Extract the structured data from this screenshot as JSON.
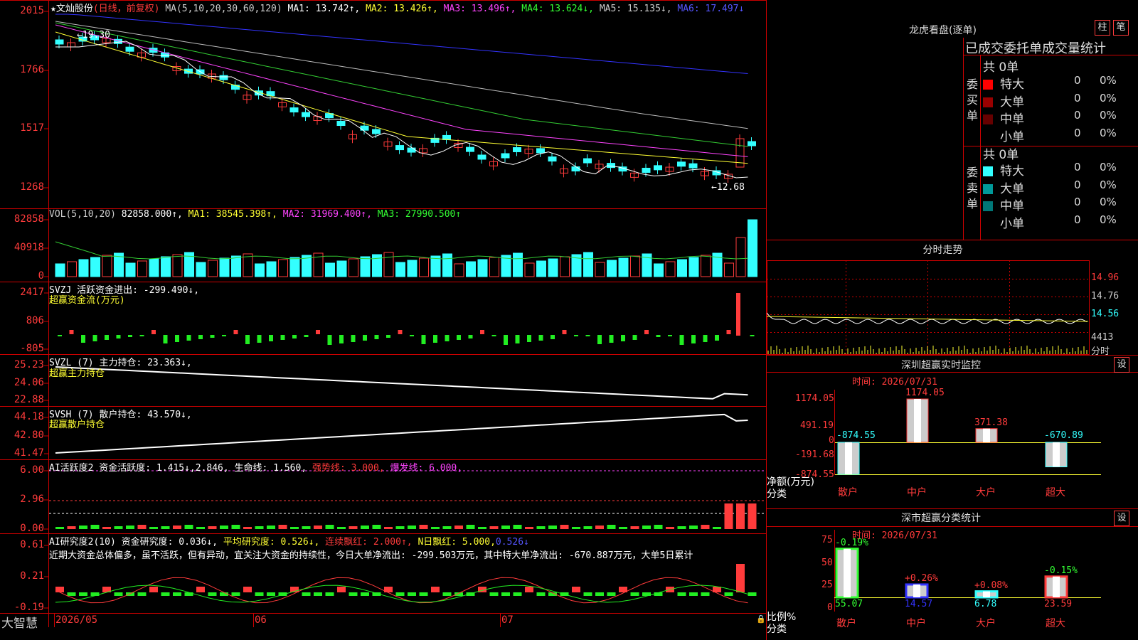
{
  "main_chart": {
    "header": {
      "stock": "★文灿股份",
      "mode": "(日线，前复权)",
      "ma_def": "MA(5,10,20,30,60,120)",
      "ma1": "MA1: 13.742↑,",
      "ma2": "MA2: 13.426↑,",
      "ma3": "MA3: 13.496↑,",
      "ma4": "MA4: 13.624↓,",
      "ma5": "MA5: 15.135↓,",
      "ma6": "MA6: 17.497↓"
    },
    "y_ticks": [
      "2015",
      "1766",
      "1517",
      "1268"
    ],
    "annotations": {
      "high": "←19.30",
      "low": "←12.68"
    },
    "colors": {
      "ma1": "#ffffff",
      "ma2": "#ffff33",
      "ma3": "#ff44ff",
      "ma4": "#33cc33",
      "ma5": "#bbbbbb",
      "ma6": "#3333ff",
      "up": "#ff3b3b",
      "down": "#33ffff"
    }
  },
  "volume": {
    "title": "VOL(5,10,20)",
    "value": "82858.000↑,",
    "ma1": "MA1: 38545.398↑,",
    "ma2": "MA2: 31969.400↑,",
    "ma3": "MA3: 27990.500↑",
    "y_ticks": [
      "82858",
      "40918",
      "0"
    ]
  },
  "svzj": {
    "title": "SVZJ  活跃资金进出: -299.490↓,",
    "subtitle": "超赢资金流(万元)",
    "y_ticks": [
      "2417",
      "806",
      "-805"
    ]
  },
  "svzl": {
    "title": "SVZL (7) 主力持仓: 23.363↓,",
    "subtitle": "超赢主力持仓",
    "y_ticks": [
      "25.23",
      "24.06",
      "22.88"
    ]
  },
  "svsh": {
    "title": "SVSH (7) 散户持仓: 43.570↓,",
    "subtitle": "超赢散户持仓",
    "y_ticks": [
      "44.18",
      "42.80",
      "41.47"
    ]
  },
  "ai_active": {
    "title": "AI活跃度2 资金活跃度: 1.415↓,",
    "v2": "2.846,",
    "life": "生命线: 1.560,",
    "strong": "强势线: 3.000,",
    "burst": "爆发线: 6.000,",
    "y_ticks": [
      "6.00",
      "2.96",
      "0.00"
    ]
  },
  "ai_research": {
    "title": "AI研究度2(10) 资金研究度: 0.036↓,",
    "avg": "平均研究度: 0.526↓,",
    "cont": "连续飘红: 2.000↑,",
    "nday": "N日飘红: 5.000,",
    "last": "0.526↓",
    "text": "近期大资金总体偏多，虽不活跃，但有异动，宜关注大资金的持续性，今日大单净流出: -299.503万元，其中特大单净流出: -670.887万元，大单5日累计",
    "y_ticks": [
      "0.61",
      "0.21",
      "-0.19"
    ]
  },
  "time_axis": {
    "brand": "大智慧",
    "labels": [
      "2026/05",
      "06",
      "07"
    ]
  },
  "right_panel": {
    "lhkp_title": "龙虎看盘(逐单)",
    "btn_zhu": "柱",
    "btn_bi": "笔",
    "stats_title": "已成交委托单成交量统计",
    "buy_label": "委买单",
    "sell_label": "委卖单",
    "buy_total": "共 0单",
    "sell_total": "共 0单",
    "buy_rows": [
      {
        "name": "特大",
        "count": "0",
        "pct": "0%",
        "color": "#ff0000"
      },
      {
        "name": "大单",
        "count": "0",
        "pct": "0%",
        "color": "#990000"
      },
      {
        "name": "中单",
        "count": "0",
        "pct": "0%",
        "color": "#660000"
      },
      {
        "name": "小单",
        "count": "0",
        "pct": "0%",
        "color": ""
      }
    ],
    "sell_rows": [
      {
        "name": "特大",
        "count": "0",
        "pct": "0%",
        "color": "#33ffff"
      },
      {
        "name": "大单",
        "count": "0",
        "pct": "0%",
        "color": "#009999"
      },
      {
        "name": "中单",
        "count": "0",
        "pct": "0%",
        "color": "#007777"
      },
      {
        "name": "小单",
        "count": "0",
        "pct": "0%",
        "color": ""
      }
    ],
    "intraday": {
      "title": "分时走势",
      "y_ticks": [
        "14.96",
        "14.76",
        "14.56"
      ],
      "vol_tick": "4413",
      "label": "分时"
    },
    "sz_monitor": {
      "title": "深圳超赢实时监控",
      "btn": "设",
      "time": "时间: 2026/07/31",
      "y_ticks": [
        "1174.05",
        "491.19",
        "0",
        "-191.68",
        "-874.55"
      ],
      "ylabel": "净额(万元)",
      "xlabel": "分类",
      "chart_data": {
        "type": "bar",
        "categories": [
          "散户",
          "中户",
          "大户",
          "超大"
        ],
        "values": [
          -874.55,
          1174.05,
          371.38,
          -670.89
        ],
        "value_labels": [
          "-874.55",
          "1174.05",
          "371.38",
          "-670.89"
        ],
        "ylim": [
          -874.55,
          1174.05
        ]
      }
    },
    "sz_class": {
      "title": "深市超赢分类统计",
      "btn": "设",
      "time": "时间: 2026/07/31",
      "y_ticks": [
        "75",
        "50",
        "25",
        "0"
      ],
      "ylabel": "比例%",
      "xlabel": "分类",
      "chart_data": {
        "type": "bar",
        "categories": [
          "散户",
          "中户",
          "大户",
          "超大"
        ],
        "values": [
          55.07,
          14.57,
          6.78,
          23.59
        ],
        "changes": [
          "-0.19%",
          "+0.26%",
          "+0.08%",
          "-0.15%"
        ],
        "ylim": [
          0,
          75
        ]
      }
    }
  }
}
